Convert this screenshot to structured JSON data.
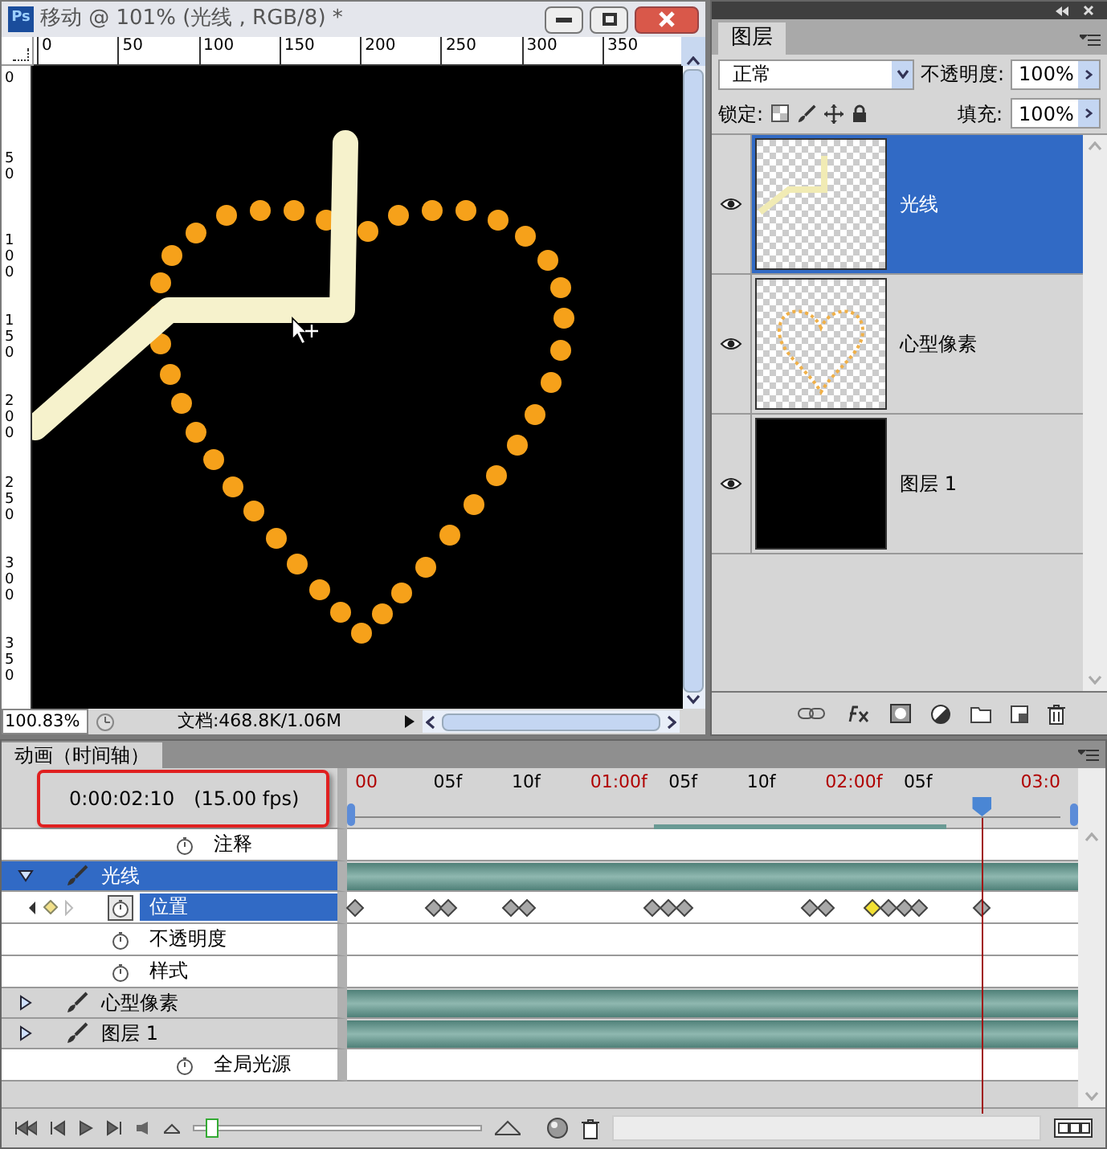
{
  "document": {
    "app_icon": "Ps",
    "title": "移动 @ 101% (光线 , RGB/8) *",
    "top_ruler": [
      "0",
      "50",
      "100",
      "150",
      "200",
      "250",
      "300",
      "350"
    ],
    "left_ruler": [
      "0",
      "50",
      "100",
      "150",
      "200",
      "250",
      "300",
      "350"
    ],
    "zoom": "100.83%",
    "doc_info": "文档:468.8K/1.06M"
  },
  "layers_panel": {
    "tab": "图层",
    "blend_mode": "正常",
    "opacity_label": "不透明度:",
    "opacity": "100%",
    "lock_label": "锁定:",
    "fill_label": "填充:",
    "fill": "100%",
    "layers": [
      {
        "name": "光线",
        "visible": true,
        "selected": true,
        "kind": "line"
      },
      {
        "name": "心型像素",
        "visible": true,
        "selected": false,
        "kind": "heart"
      },
      {
        "name": "图层 1",
        "visible": true,
        "selected": false,
        "kind": "fill"
      }
    ]
  },
  "timeline": {
    "tab": "动画（时间轴）",
    "current_time": "0:00:02:10",
    "fps": "(15.00 fps)",
    "ruler": [
      {
        "text": "00",
        "kind": "second"
      },
      {
        "text": "05f",
        "kind": "frame"
      },
      {
        "text": "10f",
        "kind": "frame"
      },
      {
        "text": "01:00f",
        "kind": "second"
      },
      {
        "text": "05f",
        "kind": "frame"
      },
      {
        "text": "10f",
        "kind": "frame"
      },
      {
        "text": "02:00f",
        "kind": "second"
      },
      {
        "text": "05f",
        "kind": "frame"
      },
      {
        "text": "03:0",
        "kind": "second"
      }
    ],
    "playhead": {
      "level": 0.889
    },
    "tracks": [
      {
        "kind": "property",
        "name": "注释",
        "selected": false,
        "stopwatch_on": false
      },
      {
        "kind": "layer",
        "name": "光线",
        "expanded": true,
        "selected": true,
        "children": [
          {
            "kind": "property",
            "name": "位置",
            "selected": true,
            "stopwatch_on": true,
            "keyframes": [
              {
                "level": 0,
                "selected": false
              },
              {
                "level": 0.111,
                "selected": false
              },
              {
                "level": 0.133,
                "selected": false
              },
              {
                "level": 0.222,
                "selected": false
              },
              {
                "level": 0.244,
                "selected": false
              },
              {
                "level": 0.422,
                "selected": false
              },
              {
                "level": 0.444,
                "selected": false
              },
              {
                "level": 0.467,
                "selected": false
              },
              {
                "level": 0.644,
                "selected": false
              },
              {
                "level": 0.667,
                "selected": false
              },
              {
                "level": 0.733,
                "selected": true
              },
              {
                "level": 0.756,
                "selected": false
              },
              {
                "level": 0.778,
                "selected": false
              },
              {
                "level": 0.8,
                "selected": false
              },
              {
                "level": 0.889,
                "selected": false
              }
            ]
          },
          {
            "kind": "property",
            "name": "不透明度",
            "selected": false,
            "stopwatch_on": false
          },
          {
            "kind": "property",
            "name": "样式",
            "selected": false,
            "stopwatch_on": false
          }
        ]
      },
      {
        "kind": "layer",
        "name": "心型像素",
        "expanded": false,
        "selected": false
      },
      {
        "kind": "layer",
        "name": "图层 1",
        "expanded": false,
        "selected": false
      },
      {
        "kind": "property",
        "name": "全局光源",
        "selected": false,
        "stopwatch_on": false
      }
    ],
    "zoom_slider": {
      "level": 0.06
    }
  }
}
